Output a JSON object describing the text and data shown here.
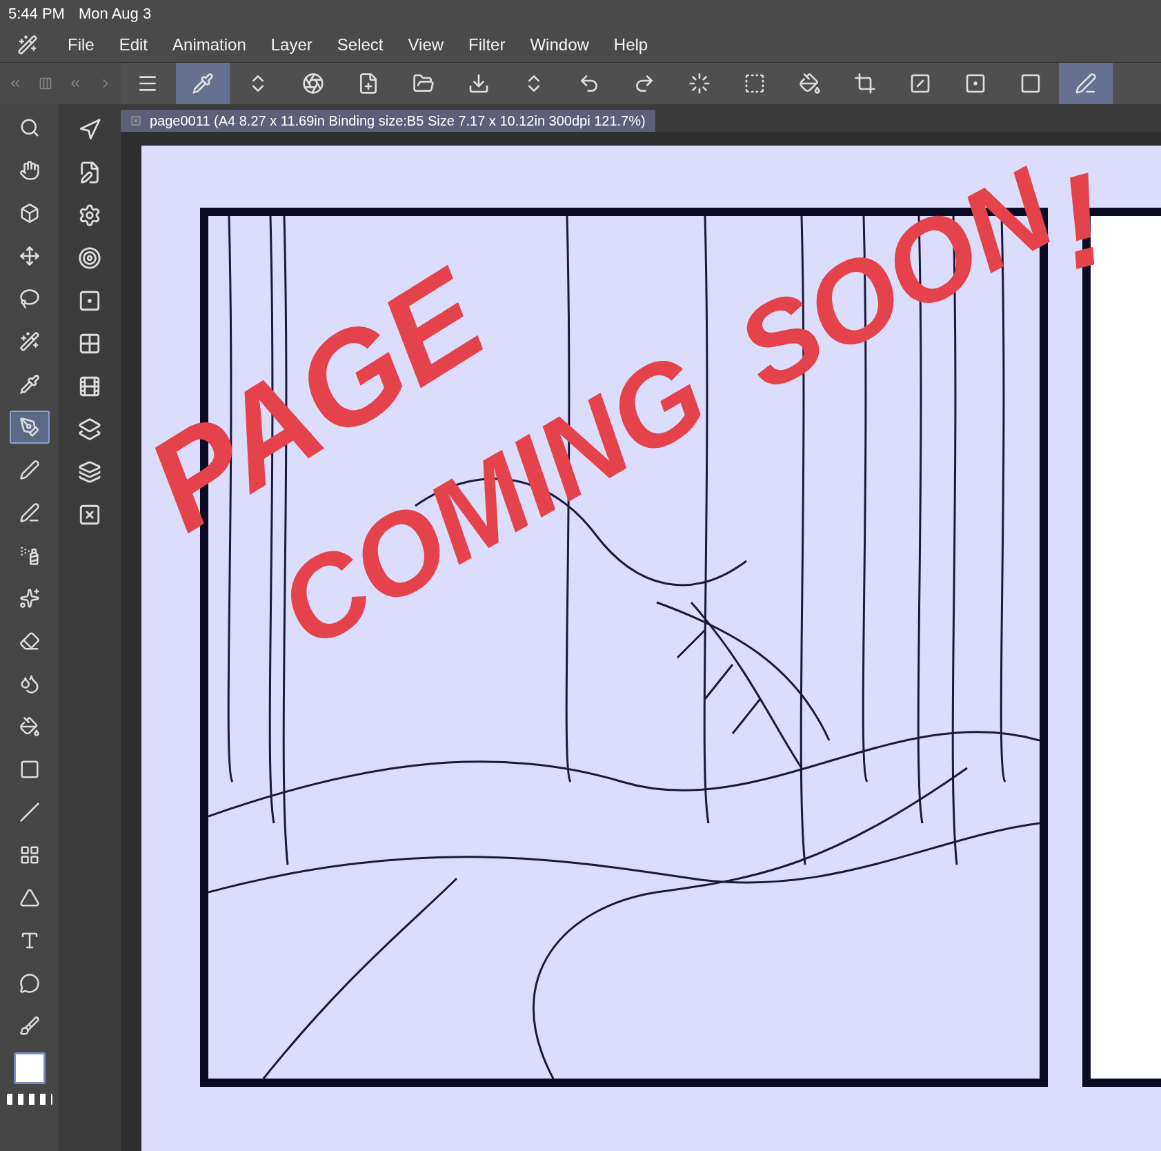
{
  "status_bar": {
    "time": "5:44 PM",
    "date": "Mon Aug 3"
  },
  "menu": [
    "File",
    "Edit",
    "Animation",
    "Layer",
    "Select",
    "View",
    "Filter",
    "Window",
    "Help"
  ],
  "toolbar": [
    {
      "selected": false
    },
    {
      "selected": true
    },
    {
      "selected": false
    },
    {
      "selected": false
    },
    {
      "selected": false
    },
    {
      "selected": false
    },
    {
      "selected": false
    },
    {
      "selected": false
    },
    {
      "selected": false
    },
    {
      "selected": false
    },
    {
      "selected": false
    },
    {
      "selected": false
    },
    {
      "selected": false
    },
    {
      "selected": false
    },
    {
      "selected": false
    },
    {
      "selected": false
    },
    {
      "selected": false
    },
    {
      "selected": true
    }
  ],
  "tools": [
    {
      "selected": false
    },
    {
      "selected": false
    },
    {
      "selected": false
    },
    {
      "selected": false
    },
    {
      "selected": false
    },
    {
      "selected": false
    },
    {
      "selected": false
    },
    {
      "selected": true
    },
    {
      "selected": false
    },
    {
      "selected": false
    },
    {
      "selected": false
    },
    {
      "selected": false
    },
    {
      "selected": false
    },
    {
      "selected": false
    },
    {
      "selected": false
    },
    {
      "selected": false
    },
    {
      "selected": false
    },
    {
      "selected": false
    },
    {
      "selected": false
    },
    {
      "selected": false
    },
    {
      "selected": false
    },
    {
      "selected": false
    }
  ],
  "document_tab": {
    "title": "page0011 (A4 8.27 x 11.69in Binding size:B5 Size 7.17 x 10.12in 300dpi 121.7%)"
  },
  "canvas": {
    "lettering": [
      "PAGE",
      "COMING",
      "SOON",
      "!"
    ]
  }
}
